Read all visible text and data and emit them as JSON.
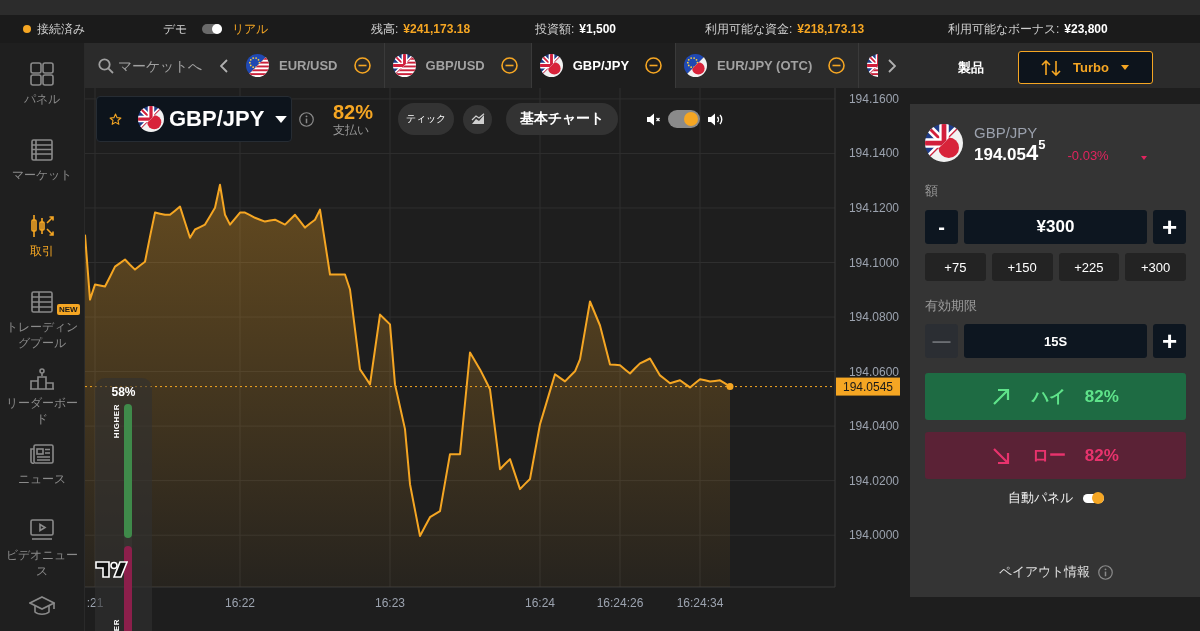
{
  "status_bar": {
    "connection": {
      "label": "接続済み",
      "connected": true
    },
    "modes": [
      {
        "label": "デモ",
        "selected": false
      },
      {
        "label": "リアル",
        "selected": true
      }
    ],
    "stats": [
      {
        "label": "残高:",
        "value": "¥241,173.18",
        "color": "#f5a623"
      },
      {
        "label": "投資額:",
        "value": "¥1,500",
        "color": "#ffffff"
      },
      {
        "label": "利用可能な資金:",
        "value": "¥218,173.13",
        "color": "#f5a623"
      },
      {
        "label": "利用可能なボーナス:",
        "value": "¥23,800",
        "color": "#ffffff"
      }
    ]
  },
  "sidebar": {
    "items": [
      {
        "label": "パネル",
        "kind": "panel",
        "selected": false
      },
      {
        "label": "マーケット",
        "kind": "market",
        "selected": false
      },
      {
        "label": "取引",
        "kind": "trade",
        "selected": true
      },
      {
        "label": "トレーディングプール",
        "kind": "pool",
        "selected": false,
        "badge": "NEW"
      },
      {
        "label": "リーダーボード",
        "kind": "leaderboard",
        "selected": false
      },
      {
        "label": "ニュース",
        "kind": "news",
        "selected": false
      },
      {
        "label": "ビデオニュース",
        "kind": "video",
        "selected": false
      },
      {
        "kind": "tutorial",
        "selected": false
      }
    ]
  },
  "market_tabs": {
    "search": {
      "placeholder": "マーケットへ"
    },
    "tabs": [
      {
        "label": "EUR/USD",
        "kind": "eu-us",
        "selected": false
      },
      {
        "label": "GBP/USD",
        "kind": "gb-us",
        "selected": false
      },
      {
        "label": "GBP/JPY",
        "kind": "gb-jp",
        "selected": true
      },
      {
        "label": "EUR/JPY (OTC)",
        "kind": "eu-jp",
        "selected": false
      },
      {
        "kind": "gb-us",
        "selected": false
      }
    ]
  },
  "product": {
    "label": "製品",
    "value": "Turbo"
  },
  "chart_toolbar": {
    "asset": {
      "label": "GBP/JPY",
      "kind": "gb-jp",
      "favorite": false
    },
    "payout": {
      "value": "82%",
      "label": "支払い"
    },
    "buttons": [
      {
        "label": "ティック",
        "kind": "chip"
      },
      {
        "kind": "icon"
      },
      {
        "label": "基本チャート",
        "kind": "menu"
      }
    ],
    "sound": {
      "on": true
    }
  },
  "chart": {
    "chart_data": {
      "type": "area",
      "categories": [
        null,
        null,
        ":21",
        null,
        null,
        null,
        null,
        null,
        null,
        null,
        null,
        null,
        null,
        null,
        null,
        null,
        null,
        null,
        null,
        null,
        null,
        null,
        null,
        null,
        null,
        null,
        null,
        null,
        null,
        null,
        null,
        "16:22",
        null,
        null,
        null,
        null,
        null,
        null,
        null,
        null,
        null,
        null,
        null,
        null,
        null,
        null,
        null,
        null,
        null,
        null,
        null,
        null,
        null,
        null,
        null,
        null,
        null,
        null,
        null,
        null,
        null,
        "16:23",
        null,
        null,
        null,
        null,
        null,
        null,
        null,
        null,
        null,
        null,
        null,
        null,
        null,
        null,
        null,
        null,
        null,
        null,
        null,
        null,
        null,
        null,
        null,
        null,
        null,
        null,
        null,
        null,
        null,
        "16:24",
        null,
        null,
        null,
        null,
        null,
        null,
        null,
        null,
        null,
        null,
        null,
        null,
        null,
        null,
        null,
        "16:24:26",
        null,
        null,
        null,
        null,
        null,
        null,
        null,
        null,
        null,
        null,
        null,
        null,
        null,
        null,
        null,
        "16:24:34",
        null,
        null,
        null,
        null,
        null,
        null
      ],
      "values": [
        194.1102,
        194.0864,
        194.0919,
        194.0916,
        194.0912,
        194.0948,
        194.0985,
        194.0998,
        194.1011,
        194.0992,
        194.0974,
        194.0989,
        194.1003,
        194.1095,
        194.1183,
        194.1179,
        194.1175,
        194.1175,
        194.119,
        194.1205,
        194.1148,
        194.1091,
        194.1121,
        194.113,
        194.1139,
        194.117,
        194.1201,
        194.1285,
        194.1175,
        194.1139,
        194.1161,
        194.1183,
        194.1183,
        194.1174,
        194.1164,
        194.1157,
        194.115,
        194.1154,
        194.1157,
        194.1148,
        194.1139,
        194.1157,
        194.1175,
        194.1152,
        194.1128,
        194.1143,
        194.1157,
        194.1194,
        194.1075,
        194.0956,
        194.0956,
        194.0956,
        194.0956,
        194.0901,
        194.0755,
        194.0608,
        194.0581,
        194.0553,
        194.0681,
        194.0809,
        194.0791,
        194.0773,
        194.0553,
        194.0471,
        194.0389,
        194.0187,
        194.0092,
        193.9997,
        194.0032,
        194.0066,
        194.0077,
        194.0088,
        194.0193,
        194.0297,
        194.0297,
        194.0297,
        194.0484,
        194.067,
        194.0639,
        194.0608,
        194.0572,
        194.0535,
        194.0389,
        194.0242,
        194.0261,
        194.0279,
        194.0224,
        194.0169,
        194.0188,
        194.0206,
        194.0307,
        194.0407,
        194.0468,
        194.0529,
        194.059,
        194.0577,
        194.0564,
        194.0583,
        194.0601,
        194.0645,
        194.0751,
        194.0857,
        194.0813,
        194.0769,
        194.0698,
        194.0626,
        194.0625,
        194.0623,
        194.0608,
        194.0593,
        194.0612,
        194.063,
        194.0639,
        194.0648,
        194.0617,
        194.0586,
        194.0572,
        194.0557,
        194.0563,
        194.0568,
        194.0555,
        194.0542,
        194.0557,
        194.0572,
        194.0568,
        194.0564,
        194.0566,
        194.0568,
        194.0557,
        194.0545
      ],
      "ylim": [
        193.981,
        194.164
      ],
      "yticks": [
        {
          "value": 194.0,
          "label": "194.0000"
        },
        {
          "value": 194.02,
          "label": "194.0200"
        },
        {
          "value": 194.04,
          "label": "194.0400"
        },
        {
          "value": 194.06,
          "label": "194.0600"
        },
        {
          "value": 194.08,
          "label": "194.0800"
        },
        {
          "value": 194.1,
          "label": "194.1000"
        },
        {
          "value": 194.12,
          "label": "194.1200"
        },
        {
          "value": 194.14,
          "label": "194.1400"
        },
        {
          "value": 194.16,
          "label": "194.1600"
        }
      ],
      "grid": true,
      "ref_lines": [
        {
          "axis": "y",
          "value": 194.0545,
          "label": "194.0545"
        }
      ]
    },
    "sentiment": {
      "value": "58%",
      "level": 0.58,
      "upper_label": "HIGHER",
      "lower_label": "ER"
    }
  },
  "trade_panel": {
    "asset": {
      "label": "GBP/JPY",
      "kind": "gb-jp",
      "price": "194.05**4**$^{5}$",
      "change": "-0.03%",
      "falling": true
    },
    "amount": {
      "label": "額",
      "value": "¥300",
      "decrease": {
        "label": "-",
        "disabled": false
      },
      "increase": {
        "label": "+",
        "disabled": false
      },
      "presets": [
        "+75",
        "+150",
        "+225",
        "+300"
      ]
    },
    "expiry": {
      "label": "有効期限",
      "value": "15S",
      "decrease": {
        "label": "—",
        "disabled": true
      },
      "increase": {
        "label": "+",
        "disabled": false
      }
    },
    "actions": [
      {
        "kind": "high",
        "label": "ハイ",
        "payout": "82%"
      },
      {
        "kind": "low",
        "label": "ロー",
        "payout": "82%"
      }
    ],
    "auto_panel": {
      "label": "自動パネル",
      "on": true
    },
    "payout_info": {
      "label": "ペイアウト情報"
    }
  }
}
